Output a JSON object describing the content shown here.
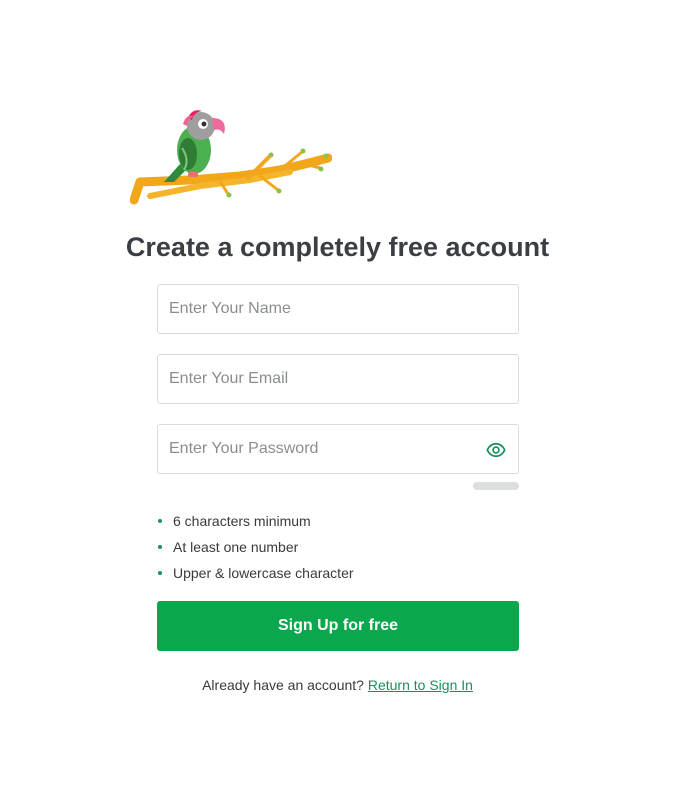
{
  "colors": {
    "brand_green": "#0aa74d",
    "link_green": "#18915a",
    "eye_green": "#18915a",
    "bullet_green": "#18915a",
    "title": "#3b3f44"
  },
  "logo": {
    "icon": "parrot-on-branch-logo"
  },
  "title": "Create a completely free account",
  "form": {
    "name": {
      "placeholder": "Enter Your Name",
      "value": ""
    },
    "email": {
      "placeholder": "Enter Your Email",
      "value": ""
    },
    "password": {
      "placeholder": "Enter Your Password",
      "value": "",
      "toggle_icon": "eye-icon"
    },
    "strength": 0
  },
  "rules": [
    "6 characters minimum",
    "At least one number",
    "Upper & lowercase character"
  ],
  "signup_button": "Sign Up for free",
  "footer": {
    "text": "Already have an account?",
    "link": "Return to Sign In"
  }
}
